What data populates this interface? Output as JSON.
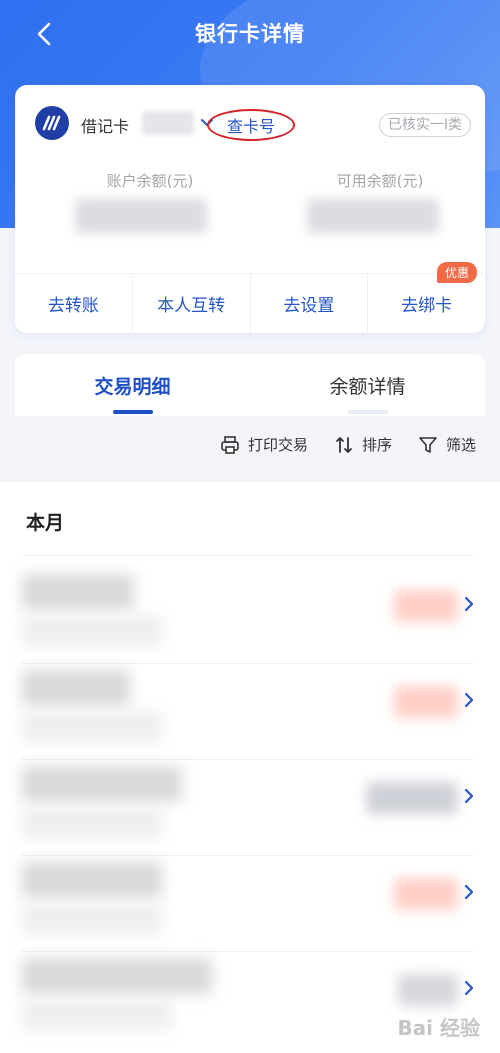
{
  "header": {
    "title": "银行卡详情",
    "back_icon": "chevron-left-icon"
  },
  "card": {
    "type_label": "借记卡",
    "action_label": "查卡号",
    "verify_badge": "已核实一I类",
    "balance_label": "账户余额(元)",
    "available_label": "可用余额(元)"
  },
  "actions": [
    {
      "label": "去转账"
    },
    {
      "label": "本人互转"
    },
    {
      "label": "去设置"
    },
    {
      "label": "去绑卡",
      "badge": "优惠"
    }
  ],
  "tabs": [
    {
      "label": "交易明细",
      "active": true
    },
    {
      "label": "余额详情",
      "active": false
    }
  ],
  "tools": {
    "print": "打印交易",
    "sort": "排序",
    "filter": "筛选"
  },
  "section": {
    "month": "本月"
  },
  "watermark": "Bai 经验",
  "colors": {
    "primary": "#1f4fc5",
    "header_blue": "#3c7cf3",
    "highlight_red": "#d4262b",
    "promo_orange": "#f06a45",
    "income_amount": "#ffcfc6",
    "expense_amount": "#cfd1d8"
  }
}
